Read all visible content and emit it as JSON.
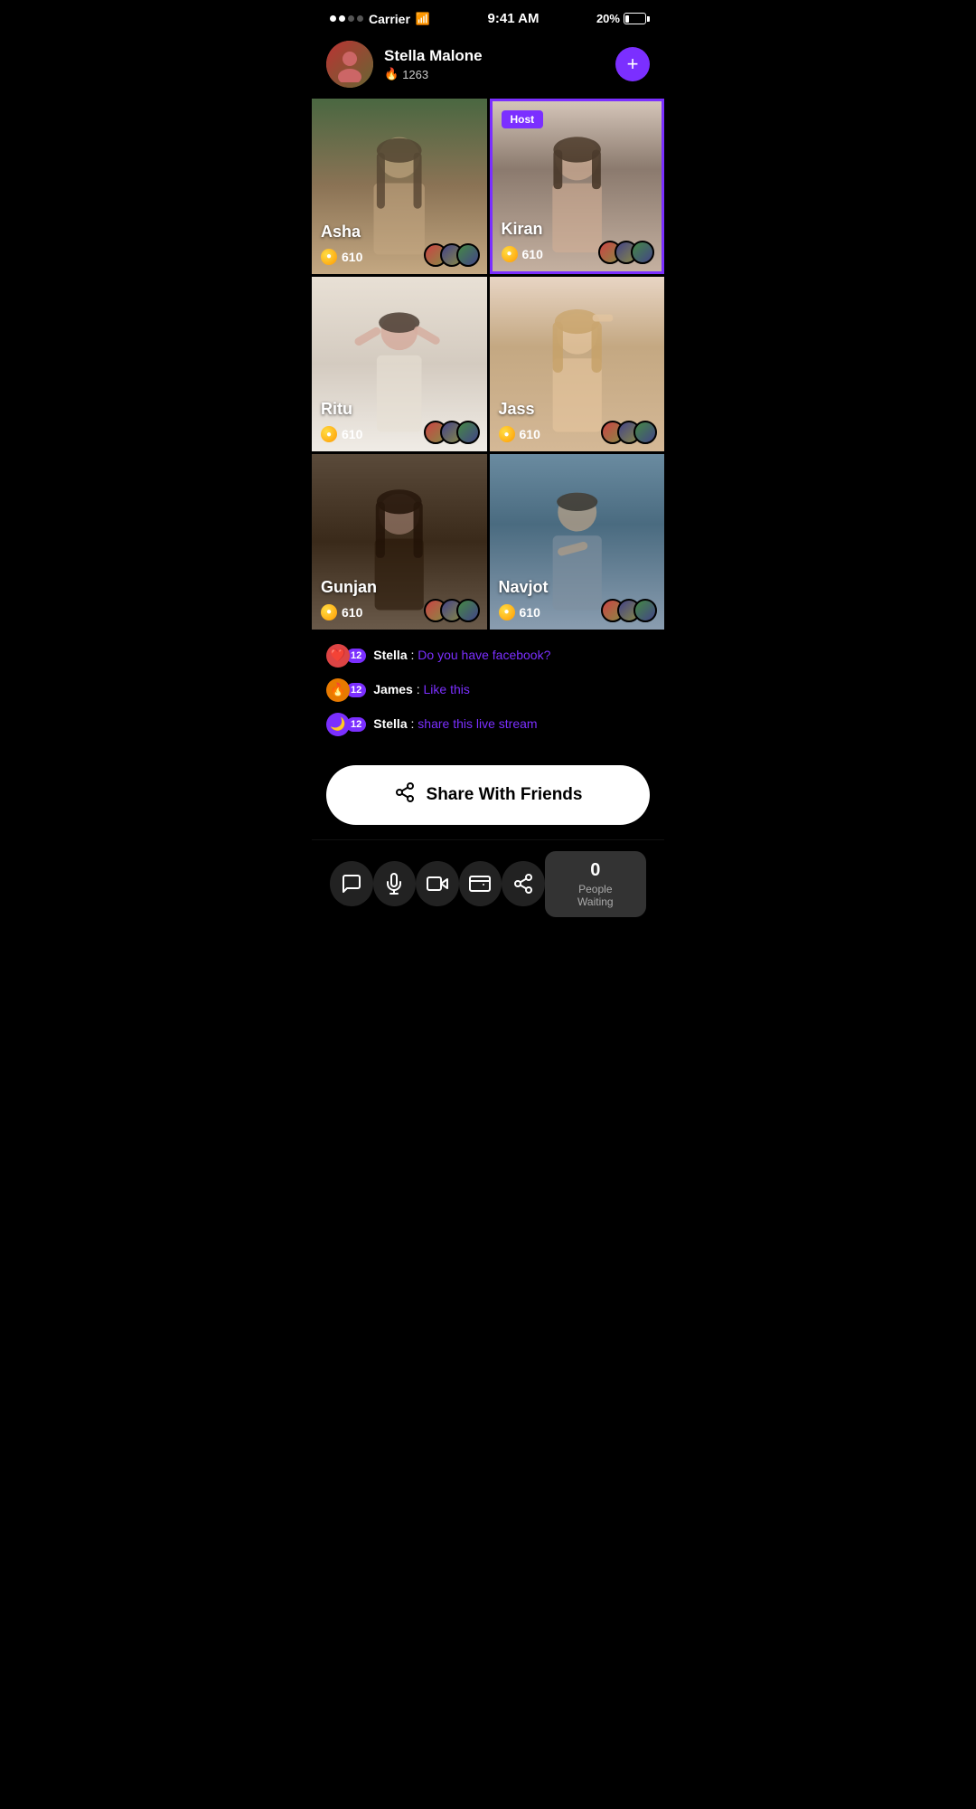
{
  "statusBar": {
    "carrier": "Carrier",
    "time": "9:41 AM",
    "battery": "20%"
  },
  "userCard": {
    "name": "Stella Malone",
    "score": "1263",
    "addButton": "+"
  },
  "grid": [
    {
      "id": "asha",
      "name": "Asha",
      "score": "610",
      "isHost": false,
      "bgClass": "bg-asha"
    },
    {
      "id": "kiran",
      "name": "Kiran",
      "score": "610",
      "isHost": true,
      "bgClass": "bg-kiran"
    },
    {
      "id": "ritu",
      "name": "Ritu",
      "score": "610",
      "isHost": false,
      "bgClass": "bg-ritu"
    },
    {
      "id": "jass",
      "name": "Jass",
      "score": "610",
      "isHost": false,
      "bgClass": "bg-jass"
    },
    {
      "id": "gunjan",
      "name": "Gunjan",
      "score": "610",
      "isHost": false,
      "bgClass": "bg-gunjan"
    },
    {
      "id": "navjot",
      "name": "Navjot",
      "score": "610",
      "isHost": false,
      "bgClass": "bg-navjot"
    }
  ],
  "chat": {
    "messages": [
      {
        "badgeType": "pink",
        "badgeIcon": "❤️",
        "badgeNum": "12",
        "username": "Stella",
        "separator": " : ",
        "message": "Do you have facebook?"
      },
      {
        "badgeType": "orange",
        "badgeIcon": "🔥",
        "badgeNum": "12",
        "username": "James",
        "separator": " : ",
        "message": "Like this"
      },
      {
        "badgeType": "purple",
        "badgeIcon": "🌙",
        "badgeNum": "12",
        "username": "Stella",
        "separator": " : ",
        "message": "share this live stream"
      }
    ]
  },
  "shareButton": {
    "label": "Share With Friends",
    "icon": "↗"
  },
  "bottomBar": {
    "icons": [
      {
        "id": "chat",
        "symbol": "💬"
      },
      {
        "id": "mic",
        "symbol": "🎤"
      },
      {
        "id": "video",
        "symbol": "🎥"
      },
      {
        "id": "wallet",
        "symbol": "👛"
      },
      {
        "id": "share",
        "symbol": "↗"
      }
    ],
    "waitingCount": "0",
    "waitingLabel": "People Waiting"
  }
}
